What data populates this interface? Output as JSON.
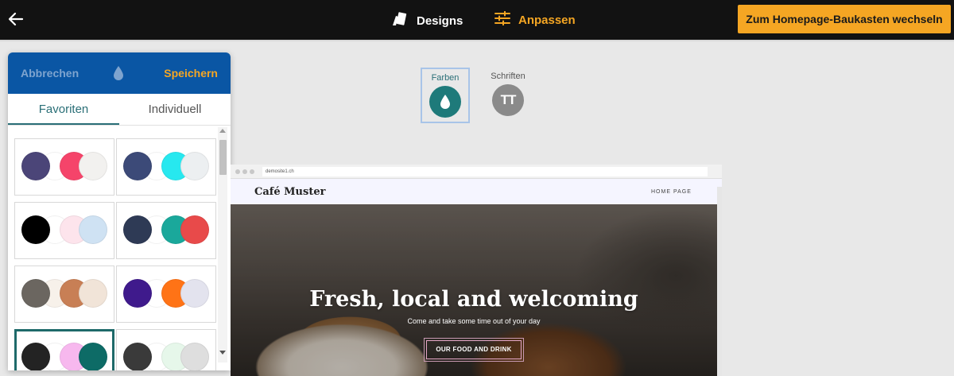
{
  "topbar": {
    "designs_label": "Designs",
    "anpassen_label": "Anpassen",
    "switch_button": "Zum Homepage-Baukasten wechseln",
    "accent": "#f5a623"
  },
  "panel": {
    "cancel_label": "Abbrechen",
    "save_label": "Speichern",
    "header_color": "#0a56a4",
    "tabs": [
      {
        "label": "Favoriten",
        "active": true
      },
      {
        "label": "Individuell",
        "active": false
      }
    ],
    "palettes": [
      {
        "colors": [
          "#4b4578",
          "#ffffff",
          "#f5446a",
          "#f2f1ef"
        ],
        "selected": false
      },
      {
        "colors": [
          "#3c4a78",
          "#ffffff",
          "#27e8ef",
          "#eceff1"
        ],
        "selected": false
      },
      {
        "colors": [
          "#000000",
          "#ffffff",
          "#fde4ec",
          "#cfe2f3"
        ],
        "selected": false
      },
      {
        "colors": [
          "#2e3a55",
          "#ffffff",
          "#1aa89b",
          "#e84a4a"
        ],
        "selected": false
      },
      {
        "colors": [
          "#6b6660",
          "#f7f1ea",
          "#c87f55",
          "#f1e4d8"
        ],
        "selected": false
      },
      {
        "colors": [
          "#3f1a8c",
          "#ffffff",
          "#ff7316",
          "#e3e3ee"
        ],
        "selected": false
      },
      {
        "colors": [
          "#232323",
          "#ffffff",
          "#f7b8ee",
          "#0d6b66"
        ],
        "selected": true
      },
      {
        "colors": [
          "#3a3a3a",
          "#ffffff",
          "#e6f7ea",
          "#dedede"
        ],
        "selected": false
      }
    ]
  },
  "modes": {
    "farben_label": "Farben",
    "farben_color": "#1e7a7a",
    "schriften_label": "Schriften",
    "schriften_color": "#8a8a8a",
    "schriften_icon_text": "TT"
  },
  "preview": {
    "url": "demosite1.ch",
    "site_title": "Café Muster",
    "menu_item": "HOME PAGE",
    "hero_title": "Fresh, local and welcoming",
    "hero_subtitle": "Come and take some time out of your day",
    "hero_button": "OUR FOOD AND DRINK"
  }
}
